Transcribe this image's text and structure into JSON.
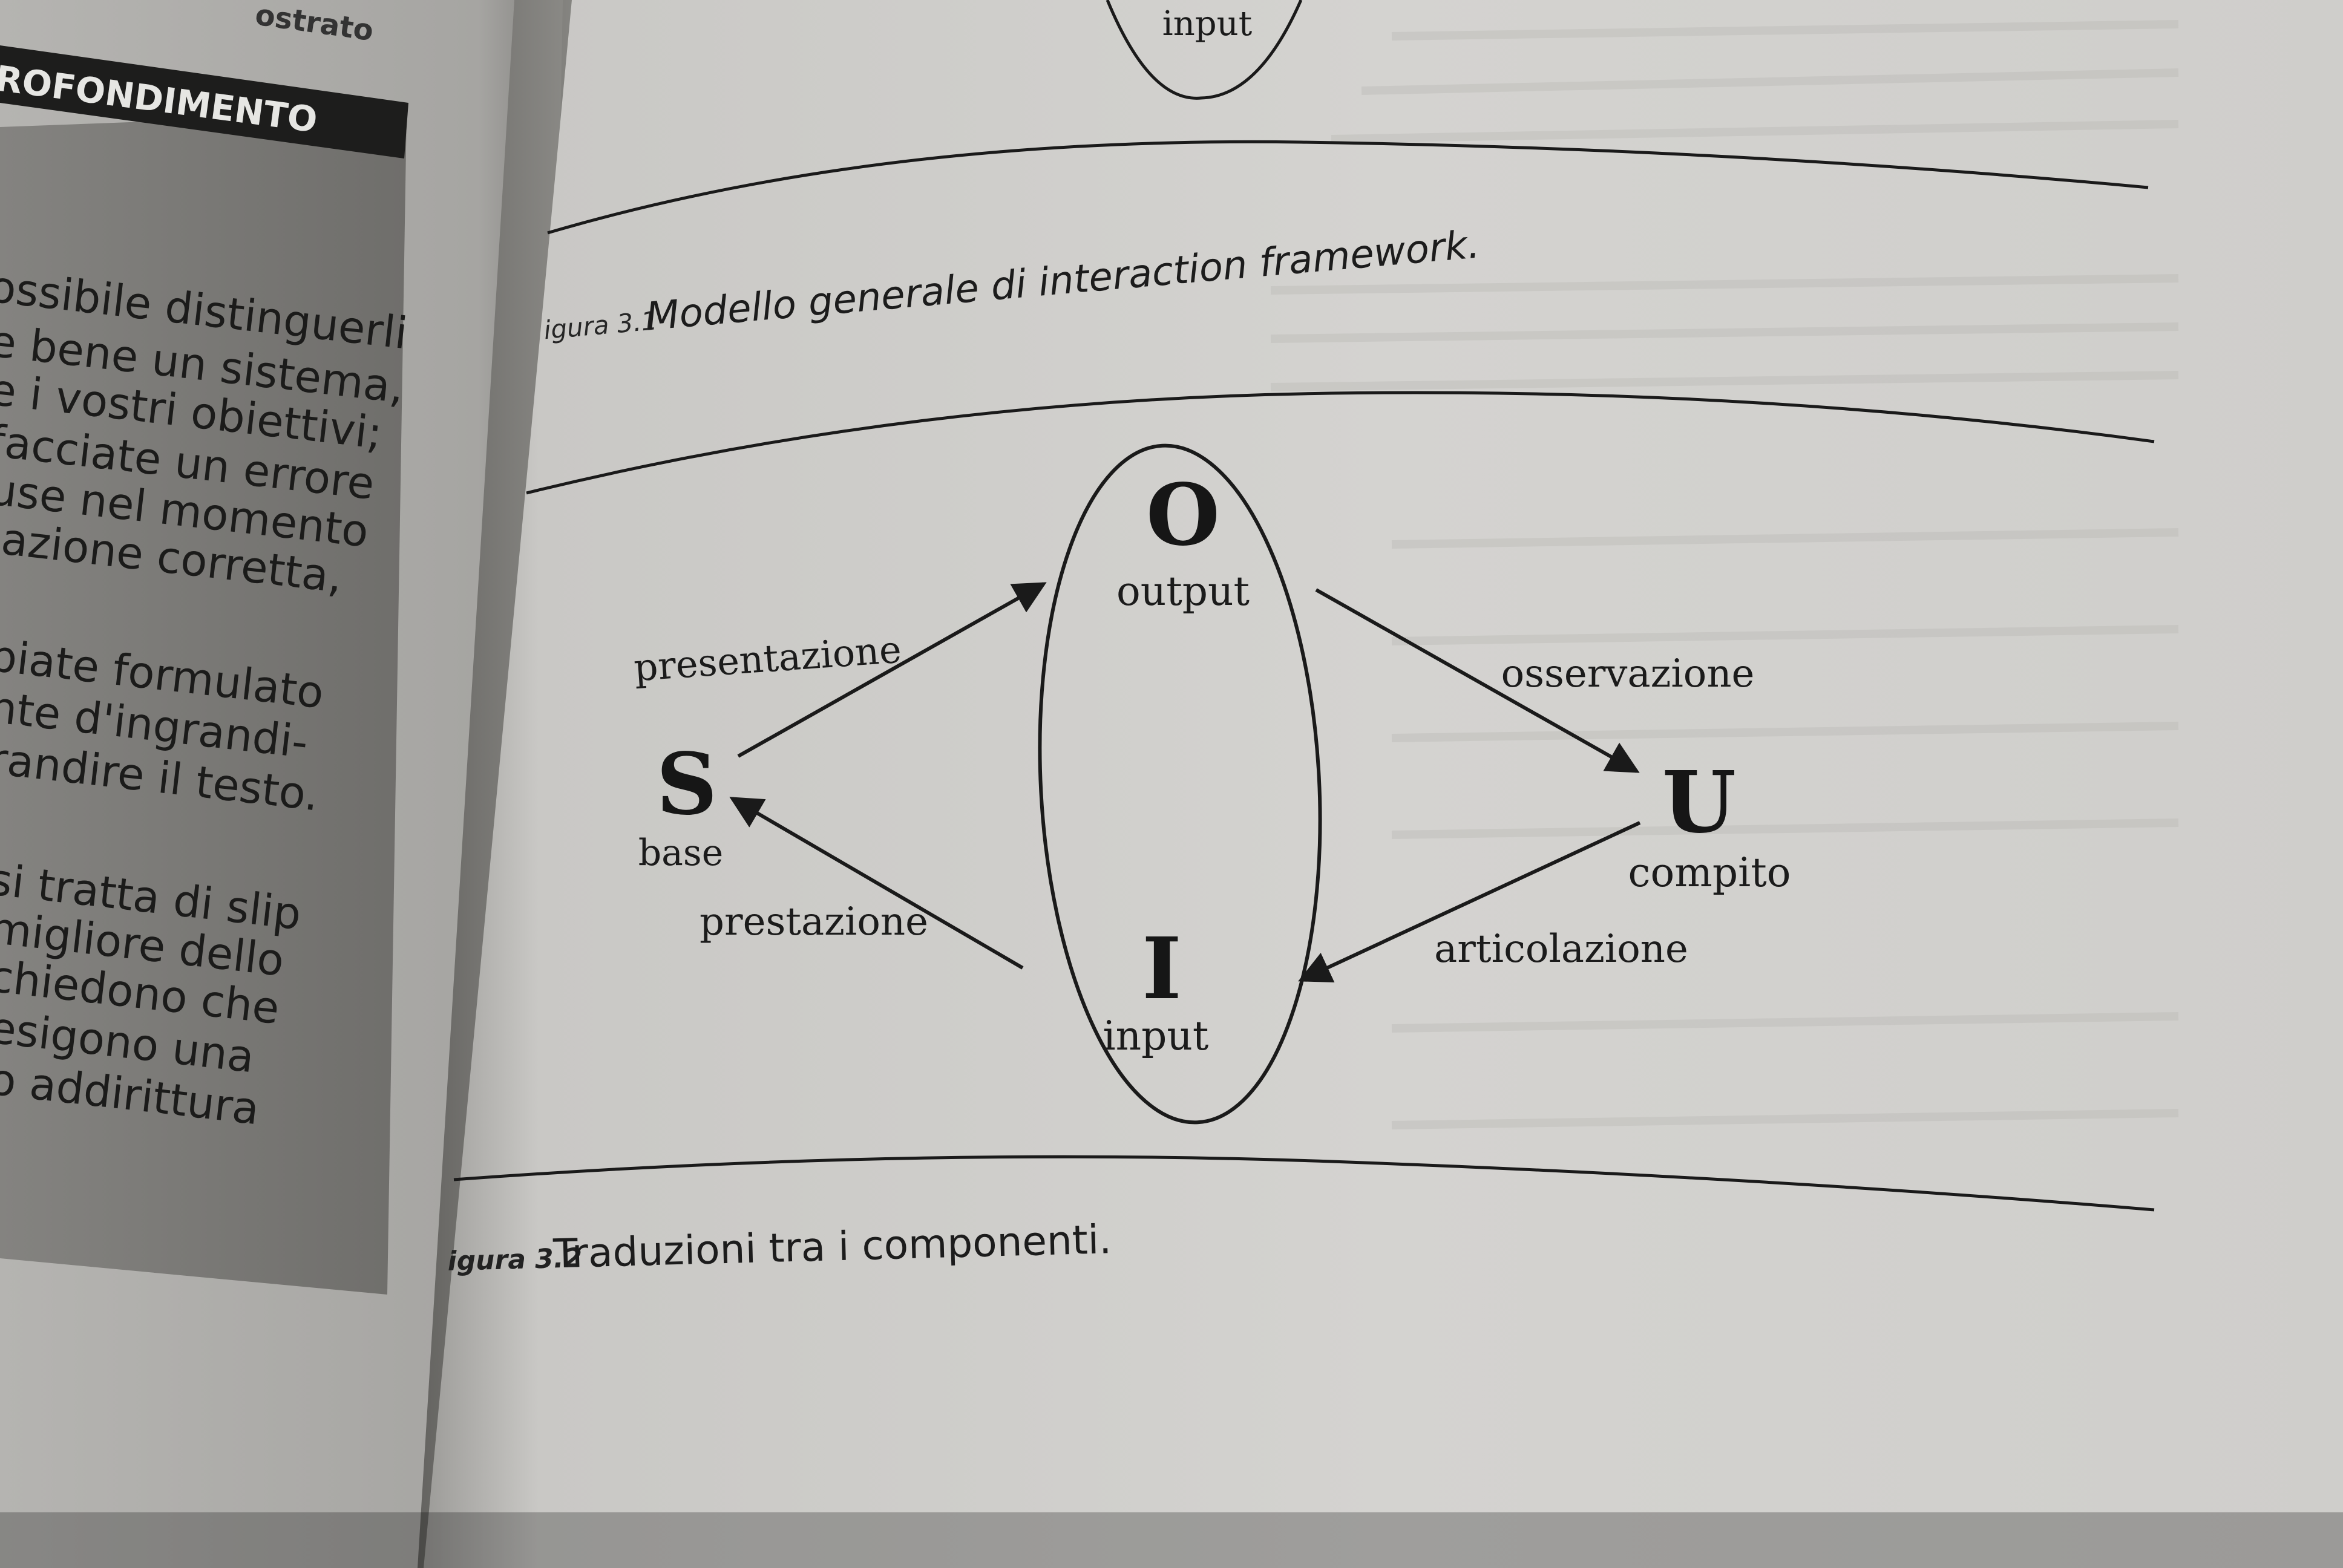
{
  "photo": {
    "left_page": {
      "box_heading": "ROFONDIMENTO",
      "corner_text": "ostrato",
      "lines": [
        "ossibile distinguerli",
        "e bene un sistema,",
        "e i vostri obiettivi;",
        "facciate un errore",
        "use nel momento",
        "'azione corretta,",
        "biate formulato",
        "nte d'ingrandi-",
        "randire il testo.",
        "si tratta di slip",
        "migliore dello",
        "chiedono che",
        "esigono una",
        "o addirittura"
      ]
    },
    "right_page": {
      "top_node_label": "input",
      "figure_31": {
        "number": "igura 3.1",
        "caption": "Modello generale di interaction framework."
      },
      "diagram": {
        "nodes": {
          "O": {
            "letter": "O",
            "label": "output"
          },
          "I": {
            "letter": "I",
            "label": "input"
          },
          "S": {
            "letter": "S",
            "label": "base"
          },
          "U": {
            "letter": "U",
            "label": "compito"
          }
        },
        "edges": {
          "s_to_o": "presentazione",
          "o_to_u": "osservazione",
          "u_to_i": "articolazione",
          "i_to_s": "prestazione"
        }
      },
      "figure_32": {
        "number": "igura 3.2",
        "caption": "Traduzioni tra i componenti."
      }
    }
  }
}
